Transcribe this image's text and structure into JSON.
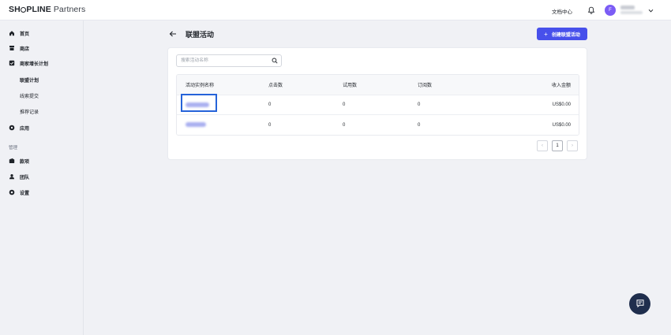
{
  "topbar": {
    "logo_brand_pre": "SH",
    "logo_brand_post": "PLINE",
    "logo_suffix": " Partners",
    "doc_link": "文档中心",
    "avatar_initial": "F",
    "icons": [
      "bell-icon",
      "chevron-down-icon"
    ]
  },
  "sidebar": {
    "items": [
      {
        "label": "首页",
        "icon": "home-icon"
      },
      {
        "label": "商店",
        "icon": "store-icon"
      },
      {
        "label": "商家增长计划",
        "icon": "growth-icon"
      }
    ],
    "sub_items": [
      {
        "label": "联盟计划",
        "active": true
      },
      {
        "label": "线索提交",
        "active": false
      },
      {
        "label": "推荐记录",
        "active": false
      }
    ],
    "apps": {
      "label": "应用",
      "icon": "apps-icon"
    },
    "group_label": "管理",
    "manage_items": [
      {
        "label": "款项",
        "icon": "wallet-icon"
      },
      {
        "label": "团队",
        "icon": "team-icon"
      },
      {
        "label": "设置",
        "icon": "gear-icon"
      }
    ]
  },
  "page": {
    "title": "联盟活动",
    "create_button": "创建联盟活动"
  },
  "search": {
    "placeholder": "搜索活动名称",
    "value": ""
  },
  "table": {
    "columns": [
      "活动实例名称",
      "点击数",
      "试用数",
      "订阅数",
      "收入金额"
    ],
    "rows": [
      {
        "name": "",
        "clicks": "0",
        "trials": "0",
        "subscriptions": "0",
        "revenue": "US$0.00"
      },
      {
        "name": "",
        "clicks": "0",
        "trials": "0",
        "subscriptions": "0",
        "revenue": "US$0.00"
      }
    ]
  },
  "pagination": {
    "current": "1",
    "prev": "‹",
    "next": "›"
  },
  "colors": {
    "accent": "#4750eb",
    "highlight": "#2563d9",
    "chat_fab": "#1f2e4d",
    "avatar": "#7b5cf5"
  }
}
